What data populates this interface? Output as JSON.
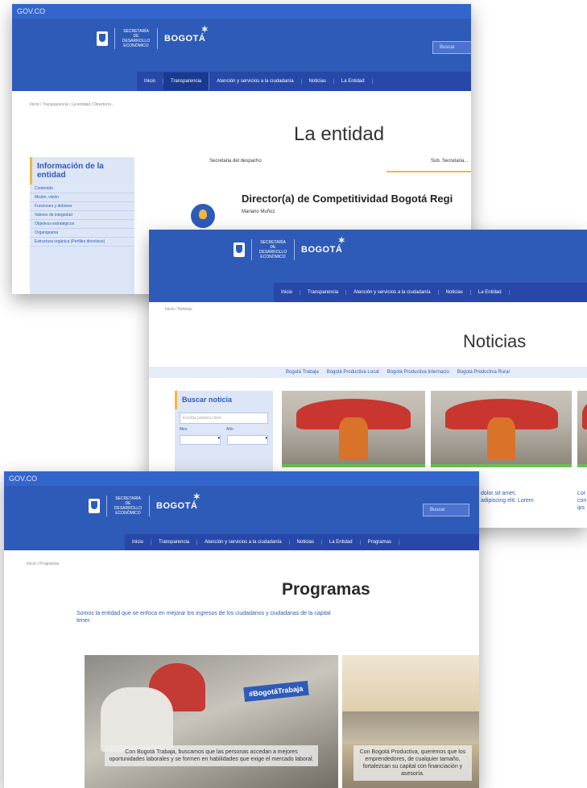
{
  "shot1": {
    "govbar": "GOV.CO",
    "secretaria": "SECRETARÍA DE DESARROLLO ECONÓMICO",
    "brand": "BOGOTÁ",
    "search_placeholder": "Buscar",
    "nav": [
      "Inicio",
      "Transparencia",
      "Atención y servicios a la ciudadanía",
      "Noticias",
      "La Entidad"
    ],
    "breadcrumb": "Inicio / Transparencia / La entidad / Directorio...",
    "title": "La entidad",
    "tabs": [
      "Secretaria del despacho",
      "Sub. Secretaria..."
    ],
    "sidebar_title": "Información de la entidad",
    "sidebar_items": [
      "Contenido",
      "Misión, visión",
      "Funciones y deberes",
      "Valores de integridad",
      "Objetivos estratégicos",
      "Organigrama",
      "Estructura orgánica (Perfiles directivos)"
    ],
    "person_role": "Director(a) de Competitividad Bogotá Regi",
    "person_name": "Mariano Muñoz"
  },
  "shot2": {
    "secretaria": "SECRETARÍA DE DESARROLLO ECONÓMICO",
    "brand": "BOGOTÁ",
    "nav": [
      "Inicio",
      "Transparencia",
      "Atención y servicios a la ciudadanía",
      "Noticias",
      "La Entidad"
    ],
    "breadcrumb": "Inicio / Noticias",
    "title": "Noticias",
    "filters": [
      "Bogotá Trabaja",
      "Bogotá Productiva Local",
      "Bogotá Productiva Internacio",
      "Bogotá Productiva Rural"
    ],
    "search_title": "Buscar noticia",
    "search_placeholder": "Escriba palabra clave",
    "month_label": "Mes",
    "year_label": "Año",
    "news_snippet_1": "dolor sit amet, adipiscing elit. Lorem",
    "news_snippet_2": "Lor con ips"
  },
  "shot3": {
    "govbar": "GOV.CO",
    "secretaria": "SECRETARÍA DE DESARROLLO ECONÓMICO",
    "brand": "BOGOTÁ",
    "search_placeholder": "Buscar",
    "nav": [
      "Inicio",
      "Transparencia",
      "Atención y servicios a la ciudadanía",
      "Noticias",
      "La Entidad",
      "Programas"
    ],
    "breadcrumb": "Inicio / Programas",
    "title": "Programas",
    "intro": "Somos la entidad que se enfoca en mejorar los ingresos de los ciudadanos y ciudadanas de la capital",
    "intro2": "tener.",
    "card1_badge": "#BogotáTrabaja",
    "card1_text": "Con Bogotá Trabaja, buscamos que las personas accedan a mejores oportunidades laborales y se formen en habilidades que exige el mercado laboral.",
    "card2_text": "Con Bogotá Productiva, queremos que los emprendedores, de cualquier tamaño, fortalezcan su capital con financiación y asesoría."
  }
}
